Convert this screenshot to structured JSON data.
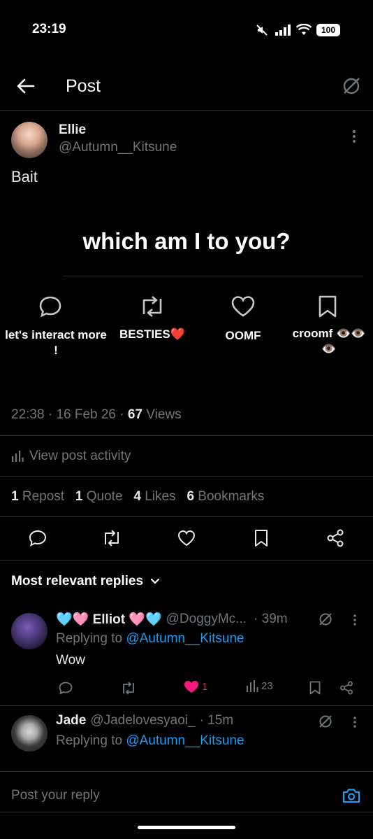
{
  "status_bar": {
    "time": "23:19",
    "battery": "100"
  },
  "header": {
    "title": "Post"
  },
  "post": {
    "author_name": "Ellie",
    "author_handle": "@Autumn__Kitsune",
    "text": "Bait",
    "image": {
      "headline": "which am I to you?",
      "options": [
        {
          "label": "let's interact more !",
          "icon": "reply-icon"
        },
        {
          "label": "BESTIES❤️",
          "icon": "repost-icon"
        },
        {
          "label": "OOMF",
          "icon": "like-icon"
        },
        {
          "label": "croomf 👁️👁️👁️",
          "icon": "bookmark-icon"
        }
      ]
    },
    "time": "22:38",
    "date": "16 Feb 26",
    "views_count": "67",
    "views_label": "Views",
    "activity_label": "View post activity",
    "stats": {
      "reposts_count": "1",
      "reposts_label": "Repost",
      "quotes_count": "1",
      "quotes_label": "Quote",
      "likes_count": "4",
      "likes_label": "Likes",
      "bookmarks_count": "6",
      "bookmarks_label": "Bookmarks"
    }
  },
  "replies_header": "Most relevant replies",
  "replies": [
    {
      "name": "🩵🩷 Elliot 🩷🩵",
      "handle": "@DoggyMc...",
      "time": "· 39m",
      "replying_prefix": "Replying to",
      "replying_handle": "@Autumn__Kitsune",
      "text": "Wow",
      "like_count": "1",
      "views_count": "23"
    },
    {
      "name": "Jade",
      "handle": "@Jadelovesyaoi_",
      "time": "· 15m",
      "replying_prefix": "Replying to",
      "replying_handle": "@Autumn__Kitsune"
    }
  ],
  "composer": {
    "placeholder": "Post your reply"
  },
  "colors": {
    "background": "#000000",
    "accent": "#1d9bf0",
    "like": "#f91880",
    "muted": "#71767b",
    "divider": "#2f3336"
  }
}
